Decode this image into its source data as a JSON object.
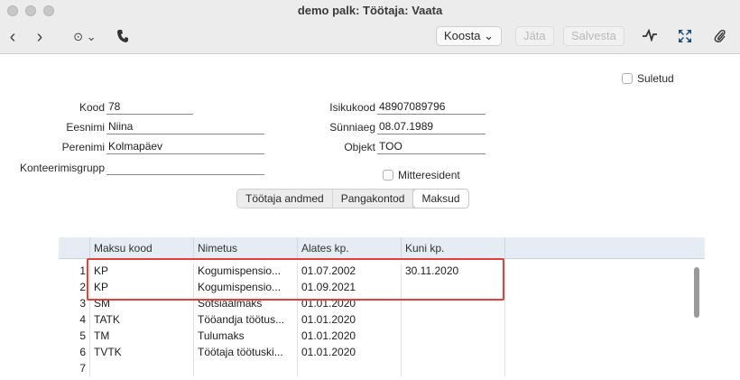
{
  "window": {
    "title": "demo palk: Töötaja: Vaata"
  },
  "toolbar": {
    "back": "‹",
    "forward": "›",
    "more": "⊙ ⌄",
    "koosta_label": "Koosta ⌄",
    "jata_label": "Jäta",
    "salvesta_label": "Salvesta"
  },
  "form": {
    "suletud_label": "Suletud",
    "kood_label": "Kood",
    "kood_value": "78",
    "eesnimi_label": "Eesnimi",
    "eesnimi_value": "Niina",
    "perenimi_label": "Perenimi",
    "perenimi_value": "Kolmapäev",
    "konteerimisgrupp_label": "Konteerimisgrupp",
    "konteerimisgrupp_value": "",
    "isikukood_label": "Isikukood",
    "isikukood_value": "48907089796",
    "synniaeg_label": "Sünniaeg",
    "synniaeg_value": "08.07.1989",
    "objekt_label": "Objekt",
    "objekt_value": "TOO",
    "mitteresident_label": "Mitteresident"
  },
  "tabs": [
    {
      "label": "Töötaja andmed",
      "active": false
    },
    {
      "label": "Pangakontod",
      "active": false
    },
    {
      "label": "Maksud",
      "active": true
    }
  ],
  "grid": {
    "headers": [
      "Maksu kood",
      "Nimetus",
      "Alates kp.",
      "Kuni kp."
    ],
    "rows": [
      {
        "num": "1",
        "kood": "KP",
        "nimetus": "Kogumispensio...",
        "alates": "01.07.2002",
        "kuni": "30.11.2020"
      },
      {
        "num": "2",
        "kood": "KP",
        "nimetus": "Kogumispensio...",
        "alates": "01.09.2021",
        "kuni": ""
      },
      {
        "num": "3",
        "kood": "SM",
        "nimetus": "Sotsiaalmaks",
        "alates": "01.01.2020",
        "kuni": ""
      },
      {
        "num": "4",
        "kood": "TATK",
        "nimetus": "Tööandja töötus...",
        "alates": "01.01.2020",
        "kuni": ""
      },
      {
        "num": "5",
        "kood": "TM",
        "nimetus": "Tulumaks",
        "alates": "01.01.2020",
        "kuni": ""
      },
      {
        "num": "6",
        "kood": "TVTK",
        "nimetus": "Töötaja töötuski...",
        "alates": "01.01.2020",
        "kuni": ""
      },
      {
        "num": "7",
        "kood": "",
        "nimetus": "",
        "alates": "",
        "kuni": ""
      }
    ]
  },
  "colors": {
    "highlight": "#e0413a",
    "grid_header": "#e5ecf3"
  }
}
